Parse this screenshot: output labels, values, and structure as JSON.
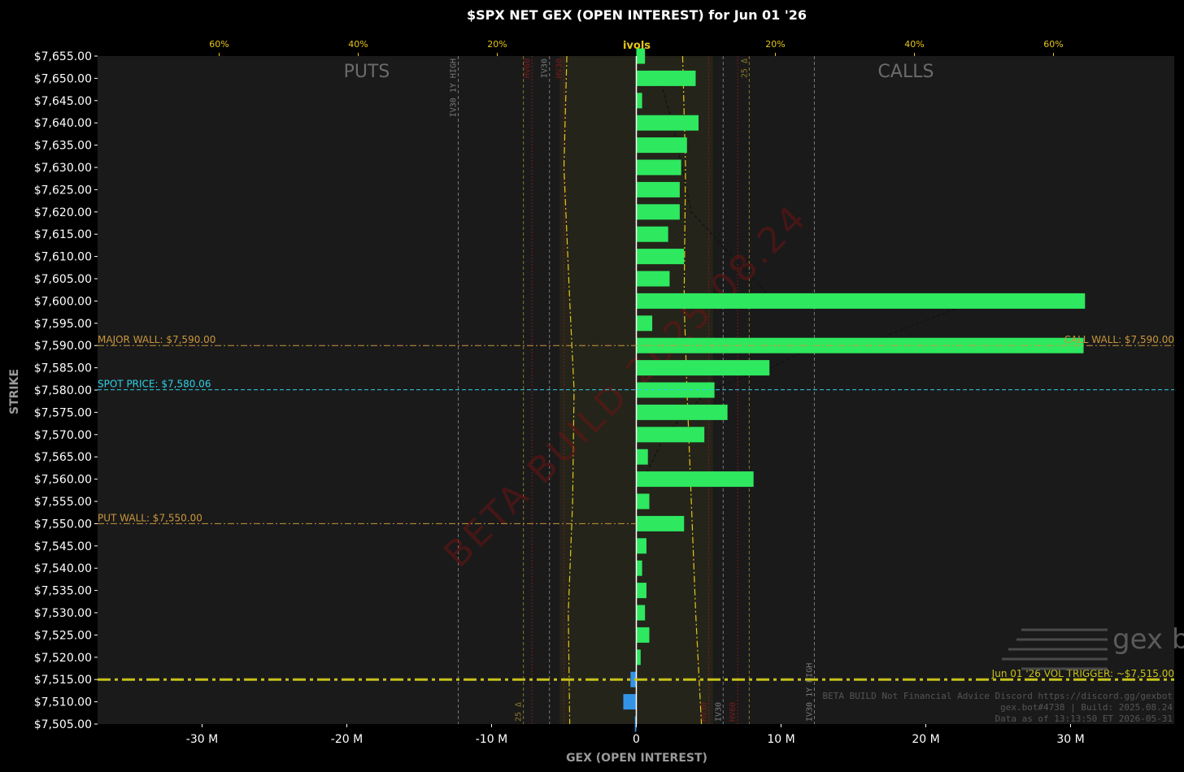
{
  "title": "$SPX NET GEX (OPEN INTEREST) for Jun 01 '26",
  "colors": {
    "background": "#000000",
    "plot_bg": "#1a1a1a",
    "positive": "#2ee85f",
    "negative": "#3394e6",
    "accent": "#e6c619",
    "wall": "#c9963b",
    "spot": "#2fd0e6",
    "trigger": "#c8c21a",
    "iv30": "#7a7a7a",
    "hv": "#7a1a1a"
  },
  "chart_data": {
    "type": "bar",
    "orientation": "horizontal",
    "title": "$SPX NET GEX (OPEN INTEREST) for Jun 01 '26",
    "xlabel": "GEX (OPEN INTEREST)",
    "ylabel": "STRIKE",
    "xlim": [
      -37,
      37
    ],
    "ylim": [
      7505,
      7655
    ],
    "x_unit_suffix": " M",
    "x_ticks": [
      -30,
      -20,
      -10,
      0,
      10,
      20,
      30
    ],
    "x_tick_labels": [
      "-30 M",
      "-20 M",
      "-10 M",
      "0",
      "10 M",
      "20 M",
      "30 M"
    ],
    "strikes": [
      7655,
      7650,
      7645,
      7640,
      7635,
      7630,
      7625,
      7620,
      7615,
      7610,
      7605,
      7600,
      7595,
      7590,
      7585,
      7580,
      7575,
      7570,
      7565,
      7560,
      7555,
      7550,
      7545,
      7540,
      7535,
      7530,
      7525,
      7520,
      7515,
      7510,
      7505
    ],
    "strike_labels": [
      "$7,655.00",
      "$7,650.00",
      "$7,645.00",
      "$7,640.00",
      "$7,635.00",
      "$7,630.00",
      "$7,625.00",
      "$7,620.00",
      "$7,615.00",
      "$7,610.00",
      "$7,605.00",
      "$7,600.00",
      "$7,595.00",
      "$7,590.00",
      "$7,585.00",
      "$7,580.00",
      "$7,575.00",
      "$7,570.00",
      "$7,565.00",
      "$7,560.00",
      "$7,555.00",
      "$7,550.00",
      "$7,545.00",
      "$7,540.00",
      "$7,535.00",
      "$7,530.00",
      "$7,525.00",
      "$7,520.00",
      "$7,515.00",
      "$7,510.00",
      "$7,505.00"
    ],
    "values": [
      0.6,
      4.1,
      0.4,
      4.3,
      3.5,
      3.1,
      3.0,
      3.0,
      2.2,
      3.3,
      2.3,
      31.0,
      1.1,
      30.9,
      9.2,
      5.4,
      6.3,
      4.7,
      0.8,
      8.1,
      0.9,
      3.3,
      0.7,
      0.4,
      0.7,
      0.6,
      0.9,
      0.3,
      -0.4,
      -0.9,
      -0.1
    ],
    "top_axis": {
      "label": "ivols",
      "ticks": [
        -60,
        -40,
        -20,
        20,
        40,
        60
      ],
      "tick_labels": [
        "60%",
        "40%",
        "20%",
        "20%",
        "40%",
        "60%"
      ]
    },
    "levels": {
      "major_wall": {
        "strike": 7590,
        "label": "MAJOR WALL: $7,590.00"
      },
      "call_wall": {
        "strike": 7590,
        "label": "CALL WALL: $7,590.00"
      },
      "spot_price": {
        "strike": 7580.06,
        "label": "SPOT PRICE: $7,580.06"
      },
      "put_wall": {
        "strike": 7550,
        "label": "PUT WALL: $7,550.00"
      },
      "vol_trigger": {
        "strike": 7515,
        "label": "Jun 01 '26 VOL TRIGGER: ~$7,515.00"
      }
    },
    "vertical_markers": [
      {
        "x": -12.3,
        "label": "IV30 1Y HIGH",
        "color": "#7a7a7a",
        "label_pos": "top"
      },
      {
        "x": -7.2,
        "label": "HV60",
        "color": "#7a1a1a",
        "label_pos": "top"
      },
      {
        "x": -6.0,
        "label": "IV30",
        "color": "#7a7a7a",
        "label_pos": "top"
      },
      {
        "x": -5.0,
        "label": "HV30",
        "color": "#7a1a1a",
        "label_pos": "top"
      },
      {
        "x": -7.8,
        "label": "25 Δ",
        "color": "#8a7a2a",
        "label_pos": "bottom"
      },
      {
        "x": 5.0,
        "label": "HV30",
        "color": "#7a1a1a",
        "label_pos": "bottom"
      },
      {
        "x": 6.0,
        "label": "IV30",
        "color": "#7a7a7a",
        "label_pos": "bottom"
      },
      {
        "x": 7.0,
        "label": "HV60",
        "color": "#7a1a1a",
        "label_pos": "bottom"
      },
      {
        "x": 7.8,
        "label": "25 Δ",
        "color": "#8a7a2a",
        "label_pos": "top"
      },
      {
        "x": 12.3,
        "label": "IV30 1Y HIGH",
        "color": "#7a7a7a",
        "label_pos": "bottom"
      }
    ],
    "section_labels": {
      "puts": "PUTS",
      "calls": "CALLS"
    },
    "grid": false
  },
  "watermark": "BETA BUILD 2025.08.24",
  "logo_text": "gex bot",
  "footer": {
    "line1": "BETA BUILD Not Financial Advice Discord https://discord.gg/gexbot",
    "line2": "gex.bot#4738 | Build: 2025.08.24",
    "line3": "Data as of 13:13:50 ET 2026-05-31"
  }
}
